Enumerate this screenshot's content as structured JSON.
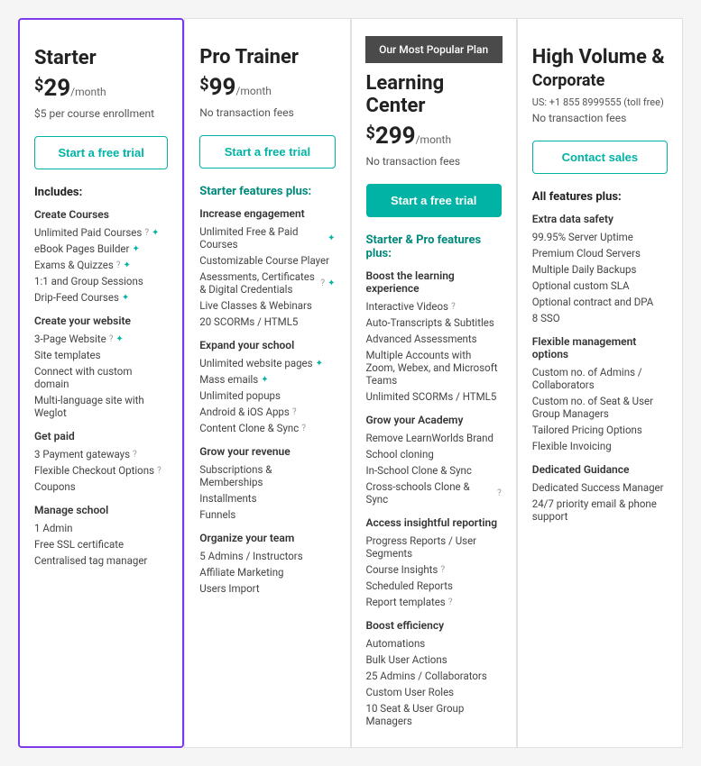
{
  "plans": [
    {
      "id": "starter",
      "name": "Starter",
      "price_symbol": "$",
      "price_amount": "29",
      "price_period": "/month",
      "tagline": "$5 per course enrollment",
      "cta_label": "Start a free trial",
      "cta_style": "outline-teal",
      "popular": false,
      "sections": [
        {
          "header": "Includes:",
          "header_style": "normal",
          "groups": [
            {
              "subheader": "Create Courses",
              "items": [
                {
                  "text": "Unlimited Paid Courses",
                  "has_help": true,
                  "has_star": true
                },
                {
                  "text": "eBook Pages Builder",
                  "has_help": false,
                  "has_star": true
                },
                {
                  "text": "Exams & Quizzes",
                  "has_help": true,
                  "has_star": true
                },
                {
                  "text": "1:1 and Group Sessions",
                  "has_help": false,
                  "has_star": false
                },
                {
                  "text": "Drip-Feed Courses",
                  "has_help": false,
                  "has_star": true
                }
              ]
            },
            {
              "subheader": "Create your website",
              "items": [
                {
                  "text": "3-Page Website",
                  "has_help": true,
                  "has_star": true
                },
                {
                  "text": "Site templates",
                  "has_help": false,
                  "has_star": false
                },
                {
                  "text": "Connect with custom domain",
                  "has_help": false,
                  "has_star": false
                },
                {
                  "text": "Multi-language site with Weglot",
                  "has_help": false,
                  "has_star": false
                }
              ]
            },
            {
              "subheader": "Get paid",
              "items": [
                {
                  "text": "3 Payment gateways",
                  "has_help": true,
                  "has_star": false
                },
                {
                  "text": "Flexible Checkout Options",
                  "has_help": true,
                  "has_star": false
                },
                {
                  "text": "Coupons",
                  "has_help": false,
                  "has_star": false
                }
              ]
            },
            {
              "subheader": "Manage school",
              "items": [
                {
                  "text": "1 Admin",
                  "has_help": false,
                  "has_star": false
                },
                {
                  "text": "Free SSL certificate",
                  "has_help": false,
                  "has_star": false
                },
                {
                  "text": "Centralised tag manager",
                  "has_help": false,
                  "has_star": false
                }
              ]
            }
          ]
        }
      ]
    },
    {
      "id": "pro-trainer",
      "name": "Pro Trainer",
      "price_symbol": "$",
      "price_amount": "99",
      "price_period": "/month",
      "tagline": "No transaction fees",
      "cta_label": "Start a free trial",
      "cta_style": "outline-teal",
      "popular": false,
      "sections": [
        {
          "header": "Starter features plus:",
          "header_style": "teal",
          "groups": [
            {
              "subheader": "Increase engagement",
              "items": [
                {
                  "text": "Unlimited Free & Paid Courses",
                  "has_help": false,
                  "has_star": true
                },
                {
                  "text": "Customizable Course Player",
                  "has_help": false,
                  "has_star": false
                },
                {
                  "text": "Asessments, Certificates & Digital Credentials",
                  "has_help": true,
                  "has_star": true
                },
                {
                  "text": "Live Classes & Webinars",
                  "has_help": false,
                  "has_star": false
                },
                {
                  "text": "20 SCORMs / HTML5",
                  "has_help": false,
                  "has_star": false
                }
              ]
            },
            {
              "subheader": "Expand your school",
              "items": [
                {
                  "text": "Unlimited website pages",
                  "has_help": false,
                  "has_star": true
                },
                {
                  "text": "Mass emails",
                  "has_help": false,
                  "has_star": true
                },
                {
                  "text": "Unlimited popups",
                  "has_help": false,
                  "has_star": false
                },
                {
                  "text": "Android & iOS Apps",
                  "has_help": true,
                  "has_star": false
                },
                {
                  "text": "Content Clone & Sync",
                  "has_help": true,
                  "has_star": false
                }
              ]
            },
            {
              "subheader": "Grow your revenue",
              "items": [
                {
                  "text": "Subscriptions & Memberships",
                  "has_help": false,
                  "has_star": false
                },
                {
                  "text": "Installments",
                  "has_help": false,
                  "has_star": false
                },
                {
                  "text": "Funnels",
                  "has_help": false,
                  "has_star": false
                }
              ]
            },
            {
              "subheader": "Organize your team",
              "items": [
                {
                  "text": "5 Admins / Instructors",
                  "has_help": false,
                  "has_star": false
                },
                {
                  "text": "Affiliate Marketing",
                  "has_help": false,
                  "has_star": false
                },
                {
                  "text": "Users Import",
                  "has_help": false,
                  "has_star": false
                }
              ]
            }
          ]
        }
      ]
    },
    {
      "id": "learning-center",
      "name": "Learning Center",
      "price_symbol": "$",
      "price_amount": "299",
      "price_period": "/month",
      "tagline": "No transaction fees",
      "cta_label": "Start a free trial",
      "cta_style": "filled-teal",
      "popular": true,
      "popular_label": "Our Most Popular Plan",
      "sections": [
        {
          "header": "Starter & Pro features plus:",
          "header_style": "teal",
          "groups": [
            {
              "subheader": "Boost the learning experience",
              "items": [
                {
                  "text": "Interactive Videos",
                  "has_help": true,
                  "has_star": false
                },
                {
                  "text": "Auto-Transcripts & Subtitles",
                  "has_help": false,
                  "has_star": false
                },
                {
                  "text": "Advanced Assessments",
                  "has_help": false,
                  "has_star": false
                },
                {
                  "text": "Multiple Accounts with Zoom, Webex, and Microsoft Teams",
                  "has_help": false,
                  "has_star": false
                },
                {
                  "text": "Unlimited SCORMs / HTML5",
                  "has_help": false,
                  "has_star": false
                }
              ]
            },
            {
              "subheader": "Grow your Academy",
              "items": [
                {
                  "text": "Remove LearnWorlds Brand",
                  "has_help": false,
                  "has_star": false
                },
                {
                  "text": "School cloning",
                  "has_help": false,
                  "has_star": false
                },
                {
                  "text": "In-School Clone & Sync",
                  "has_help": false,
                  "has_star": false
                },
                {
                  "text": "Cross-schools Clone & Sync",
                  "has_help": true,
                  "has_star": false
                }
              ]
            },
            {
              "subheader": "Access insightful reporting",
              "items": [
                {
                  "text": "Progress Reports / User Segments",
                  "has_help": false,
                  "has_star": false
                },
                {
                  "text": "Course Insights",
                  "has_help": true,
                  "has_star": false
                },
                {
                  "text": "Scheduled Reports",
                  "has_help": false,
                  "has_star": false
                },
                {
                  "text": "Report templates",
                  "has_help": true,
                  "has_star": false
                }
              ]
            },
            {
              "subheader": "Boost efficiency",
              "items": [
                {
                  "text": "Automations",
                  "has_help": false,
                  "has_star": false
                },
                {
                  "text": "Bulk User Actions",
                  "has_help": false,
                  "has_star": false
                },
                {
                  "text": "25 Admins / Collaborators",
                  "has_help": false,
                  "has_star": false
                },
                {
                  "text": "Custom User Roles",
                  "has_help": false,
                  "has_star": false
                },
                {
                  "text": "10 Seat & User Group Managers",
                  "has_help": false,
                  "has_star": false
                }
              ]
            }
          ]
        }
      ]
    },
    {
      "id": "high-volume",
      "name": "High Volume &",
      "name_line2": "Corporate",
      "price_symbol": "",
      "price_amount": "",
      "price_period": "",
      "phone_label": "US: +1 855 8999555 (toll free)",
      "tagline": "No transaction fees",
      "cta_label": "Contact sales",
      "cta_style": "outline-teal",
      "popular": false,
      "sections": [
        {
          "header": "All features plus:",
          "header_style": "normal",
          "groups": [
            {
              "subheader": "Extra data safety",
              "items": [
                {
                  "text": "99.95% Server Uptime",
                  "has_help": false,
                  "has_star": false
                },
                {
                  "text": "Premium Cloud Servers",
                  "has_help": false,
                  "has_star": false
                },
                {
                  "text": "Multiple Daily Backups",
                  "has_help": false,
                  "has_star": false
                },
                {
                  "text": "Optional custom SLA",
                  "has_help": false,
                  "has_star": false
                },
                {
                  "text": "Optional contract and DPA",
                  "has_help": false,
                  "has_star": false
                },
                {
                  "text": "8 SSO",
                  "has_help": false,
                  "has_star": false
                }
              ]
            },
            {
              "subheader": "Flexible management options",
              "items": [
                {
                  "text": "Custom no. of Admins / Collaborators",
                  "has_help": false,
                  "has_star": false
                },
                {
                  "text": "Custom no. of Seat & User Group Managers",
                  "has_help": false,
                  "has_star": false
                },
                {
                  "text": "Tailored Pricing Options",
                  "has_help": false,
                  "has_star": false
                },
                {
                  "text": "Flexible Invoicing",
                  "has_help": false,
                  "has_star": false
                }
              ]
            },
            {
              "subheader": "Dedicated Guidance",
              "items": [
                {
                  "text": "Dedicated Success Manager",
                  "has_help": false,
                  "has_star": false
                },
                {
                  "text": "24/7 priority email & phone support",
                  "has_help": false,
                  "has_star": false
                }
              ]
            }
          ]
        }
      ]
    }
  ]
}
